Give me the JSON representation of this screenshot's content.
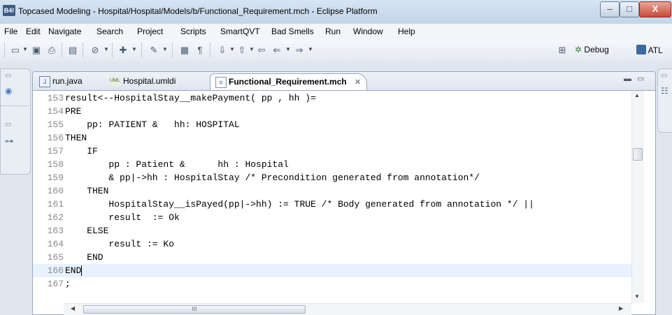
{
  "window": {
    "app_icon": "B4!",
    "title": "Topcased Modeling - Hospital/Hospital/Models/b/Functional_Requirement.mch - Eclipse Platform",
    "minimize": "–",
    "maximize": "□",
    "close": "X"
  },
  "menu": [
    "File",
    "Edit",
    "Navigate",
    "Search",
    "Project",
    "Scripts",
    "SmartQVT",
    "Bad Smells",
    "Run",
    "Window",
    "Help"
  ],
  "toolbar": {
    "perspective_debug": "Debug",
    "perspective_atl": "ATL"
  },
  "tabs": [
    {
      "label": "run.java",
      "icon": "java-file-icon"
    },
    {
      "label": "Hospital.umldi",
      "icon": "uml-diagram-icon"
    },
    {
      "label": "Functional_Requirement.mch",
      "icon": "text-file-icon",
      "active": true
    }
  ],
  "tab_close": "✕",
  "editor_lines": [
    {
      "n": "153",
      "code": "result<--HospitalStay__makePayment( pp , hh )="
    },
    {
      "n": "154",
      "code": "PRE"
    },
    {
      "n": "155",
      "code": "    pp: PATIENT &   hh: HOSPITAL"
    },
    {
      "n": "156",
      "code": "THEN"
    },
    {
      "n": "157",
      "code": "    IF"
    },
    {
      "n": "158",
      "code": "        pp : Patient &      hh : Hospital"
    },
    {
      "n": "159",
      "code": "        & pp|->hh : HospitalStay /* Precondition generated from annotation*/"
    },
    {
      "n": "160",
      "code": "    THEN"
    },
    {
      "n": "161",
      "code": "        HospitalStay__isPayed(pp|->hh) := TRUE /* Body generated from annotation */ ||"
    },
    {
      "n": "162",
      "code": "        result  := Ok"
    },
    {
      "n": "163",
      "code": "    ELSE"
    },
    {
      "n": "164",
      "code": "        result := Ko"
    },
    {
      "n": "165",
      "code": "    END"
    },
    {
      "n": "166",
      "code": "END",
      "current": true
    },
    {
      "n": "167",
      "code": ";"
    }
  ],
  "hscroll_grip": "III"
}
